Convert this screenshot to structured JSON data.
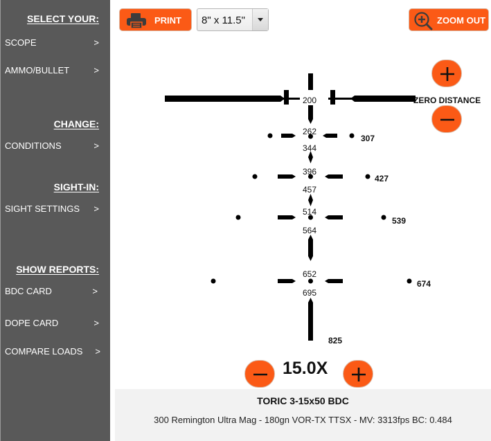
{
  "sidebar": {
    "sections": [
      {
        "heading": "SELECT YOUR:",
        "items": [
          {
            "label": "SCOPE",
            "chevron": ">"
          },
          {
            "label": "AMMO/BULLET",
            "chevron": ">"
          }
        ]
      },
      {
        "heading": "CHANGE:",
        "items": [
          {
            "label": "CONDITIONS",
            "chevron": ">"
          }
        ]
      },
      {
        "heading": "SIGHT-IN:",
        "items": [
          {
            "label": "SIGHT SETTINGS",
            "chevron": ">"
          }
        ]
      },
      {
        "heading": "SHOW REPORTS:",
        "items": [
          {
            "label": "BDC CARD",
            "chevron": ">"
          },
          {
            "label": "DOPE CARD",
            "chevron": ">"
          },
          {
            "label": "COMPARE LOADS",
            "chevron": ">"
          }
        ]
      }
    ]
  },
  "toolbar": {
    "print_label": "PRINT",
    "print_icon": "printer-icon",
    "paper_size": "8\" x 11.5\"",
    "zoom_out_label": "ZOOM OUT",
    "zoom_out_icon": "magnifier-plus-icon"
  },
  "zero_distance": {
    "label": "ZERO DISTANCE",
    "increase_icon": "plus-icon",
    "decrease_icon": "minus-icon"
  },
  "reticle": {
    "center_labels": [
      "200",
      "262",
      "344",
      "396",
      "457",
      "514",
      "564",
      "652",
      "695"
    ],
    "side_labels": [
      "307",
      "427",
      "539",
      "674",
      "825"
    ]
  },
  "magnification": {
    "value": "15.0X",
    "decrease_icon": "minus-icon",
    "increase_icon": "plus-icon"
  },
  "info": {
    "scope_name": "TORIC 3-15x50 BDC",
    "load_description": "300 Remington Ultra Mag - 180gn VOR-TX TTSX - MV: 3313fps BC: 0.484"
  },
  "colors": {
    "accent": "#fb5a16",
    "sidebar_bg": "#595959",
    "info_bg": "#f2f2f2"
  }
}
